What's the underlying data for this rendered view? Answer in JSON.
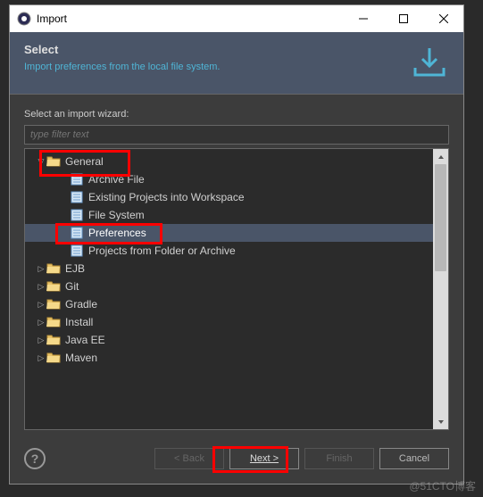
{
  "titlebar": {
    "title": "Import"
  },
  "header": {
    "title": "Select",
    "description": "Import preferences from the local file system."
  },
  "body": {
    "label": "Select an import wizard:",
    "filter_placeholder": "type filter text"
  },
  "tree": {
    "items": [
      {
        "label": "General",
        "level": 0,
        "expanded": true,
        "type": "folder"
      },
      {
        "label": "Archive File",
        "level": 1,
        "type": "file"
      },
      {
        "label": "Existing Projects into Workspace",
        "level": 1,
        "type": "file"
      },
      {
        "label": "File System",
        "level": 1,
        "type": "file"
      },
      {
        "label": "Preferences",
        "level": 1,
        "type": "file",
        "selected": true
      },
      {
        "label": "Projects from Folder or Archive",
        "level": 1,
        "type": "file"
      },
      {
        "label": "EJB",
        "level": 0,
        "expanded": false,
        "type": "folder"
      },
      {
        "label": "Git",
        "level": 0,
        "expanded": false,
        "type": "folder"
      },
      {
        "label": "Gradle",
        "level": 0,
        "expanded": false,
        "type": "folder"
      },
      {
        "label": "Install",
        "level": 0,
        "expanded": false,
        "type": "folder"
      },
      {
        "label": "Java EE",
        "level": 0,
        "expanded": false,
        "type": "folder"
      },
      {
        "label": "Maven",
        "level": 0,
        "expanded": false,
        "type": "folder"
      }
    ]
  },
  "footer": {
    "back": "< Back",
    "next": "Next >",
    "finish": "Finish",
    "cancel": "Cancel"
  },
  "watermark": "@51CTO博客"
}
